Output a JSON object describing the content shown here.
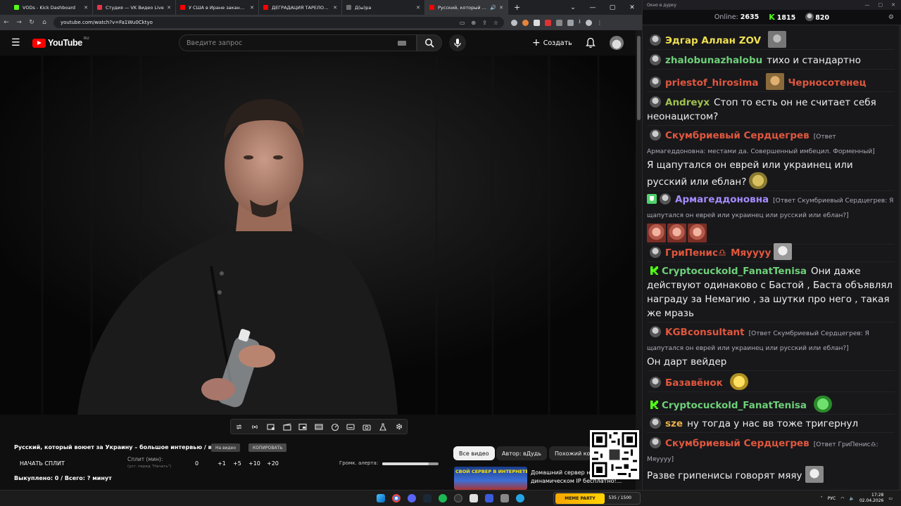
{
  "browser": {
    "tabs": [
      {
        "label": "VODs - Kick Dashboard",
        "favicon_color": "#53fc18",
        "active": false
      },
      {
        "label": "Студия — VK Видео Live",
        "favicon_color": "#e8334a",
        "active": false
      },
      {
        "label": "У США в Иране заканчиваются…",
        "favicon_color": "#ff0000",
        "active": false
      },
      {
        "label": "ДЕГРАДАЦИЯ ТАРЕЛОЧНИЦ…",
        "favicon_color": "#ff0000",
        "active": false
      },
      {
        "label": "Д(ы)ра",
        "favicon_color": "#6e6e6e",
        "active": false
      },
      {
        "label": "Русский, который воюет з…",
        "favicon_color": "#ff0000",
        "active": true
      }
    ],
    "url": "youtube.com/watch?v=Fa1Wu0Cktyo"
  },
  "youtube": {
    "logo_text": "YouTube",
    "region": "RU",
    "search_placeholder": "Введите запрос",
    "create_label": "Создать",
    "video_title": "Русский, который воюет за Украину – большое интервью / вДудь",
    "btn_on_video": "На видео",
    "btn_copy": "КОПИРОВАТЬ",
    "split_start": "НАЧАТЬ СПЛИТ",
    "split_label": "Сплит (мин):",
    "split_hint": "(уст. перед \"Начать\")",
    "split_values": [
      "0",
      "+1",
      "+5",
      "+10",
      "+20"
    ],
    "alert_label": "Громк. алерта:",
    "alert_volume_pct": 82,
    "bought": "Выкуплено: 0 / Всего: ? минут",
    "chips": [
      "Все видео",
      "Автор: вДудь",
      "Похожий ко"
    ],
    "ad_thumb_text": "СВОЙ СЕРВЕР В ИНТЕРНЕТЕ!",
    "ad_title": "Домашний сервер на динамическом IP бесплатно!..."
  },
  "chat": {
    "window_title": "Окно в дурку",
    "online_label": "Online:",
    "online_value": "2635",
    "kick_value": "1815",
    "vk_value": "820",
    "messages": [
      {
        "user": "Эдгар Аллан ZOV",
        "color": "#f0e050",
        "text": "",
        "reply": ""
      },
      {
        "user": "zhalobunazhalobu",
        "color": "#6fd07a",
        "text": "тихо и стандартно",
        "reply": ""
      },
      {
        "user": "priestof_hirosima",
        "color": "#e0573e",
        "text": "Черносотенец",
        "reply": ""
      },
      {
        "user": "Andreyx",
        "color": "#9fc14e",
        "text": "Стоп то есть он не считает себя неонацистом?",
        "reply": ""
      },
      {
        "user": "Скумбриевый Сердцегрев",
        "color": "#e0573e",
        "reply": "[Ответ Армагеддоновна: местами да. Совершенный имбецил. Форменный]",
        "text": "Я щапутался он еврей или украинец или русский или еблан?"
      },
      {
        "user": "Армагеддоновна",
        "color": "#a58cff",
        "reply": "[Ответ Скумбриевый Сердцегрев: Я щапутался он еврей или украинец или русский или еблан?]",
        "text": ""
      },
      {
        "user": "ГриПенис♎",
        "color": "#e0573e",
        "text": "Мяуууу",
        "reply": ""
      },
      {
        "user": "Cryptocuckold_FanatTenisa",
        "color": "#6fd07a",
        "text": "Они даже действуют одинаково с Бастой , Баста объявлял награду за Немагию , за шутки про него , такая же мразь",
        "reply": ""
      },
      {
        "user": "KGBconsultant",
        "color": "#e0573e",
        "reply": "[Ответ Скумбриевый Сердцегрев: Я щапутался он еврей или украинец или русский или еблан?]",
        "text": "Он дарт вейдер"
      },
      {
        "user": "Базавёнок",
        "color": "#e0573e",
        "text": "",
        "reply": ""
      },
      {
        "user": "Cryptocuckold_FanatTenisa",
        "color": "#6fd07a",
        "text": "",
        "reply": ""
      },
      {
        "user": "sze",
        "color": "#e8b04a",
        "text": "ну тогда у нас вв тоже тригернул",
        "reply": ""
      },
      {
        "user": "Скумбриевый Сердцегрев",
        "color": "#e0573e",
        "reply": "[Ответ ГриПенис♎: Мяуууу]",
        "text": "Разве грипенисы говорят мяяу"
      }
    ]
  },
  "taskbar": {
    "lang": "РУС",
    "time": "17:28",
    "date": "02.04.2026",
    "widget_logo": "MEME PARTY",
    "widget_count": "535 / 1500"
  }
}
